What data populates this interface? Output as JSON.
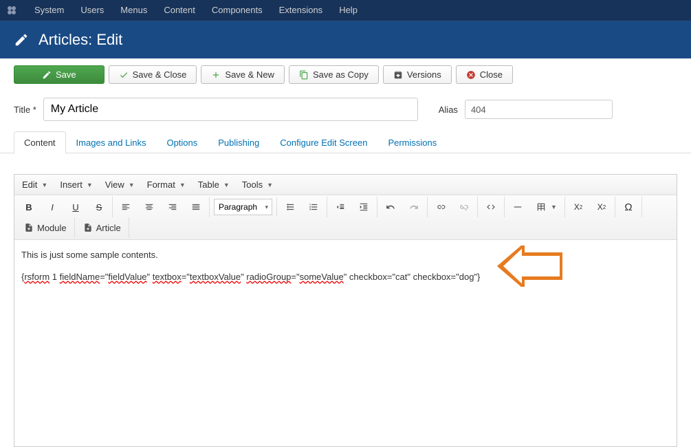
{
  "topnav": {
    "items": [
      "System",
      "Users",
      "Menus",
      "Content",
      "Components",
      "Extensions",
      "Help"
    ]
  },
  "header": {
    "title": "Articles: Edit"
  },
  "toolbar": {
    "save": "Save",
    "save_close": "Save & Close",
    "save_new": "Save & New",
    "save_copy": "Save as Copy",
    "versions": "Versions",
    "close": "Close"
  },
  "form": {
    "title_label": "Title *",
    "title_value": "My Article",
    "alias_label": "Alias",
    "alias_value": "404"
  },
  "tabs": {
    "content": "Content",
    "images": "Images and Links",
    "options": "Options",
    "publishing": "Publishing",
    "configure": "Configure Edit Screen",
    "permissions": "Permissions"
  },
  "editor_menus": {
    "edit": "Edit",
    "insert": "Insert",
    "view": "View",
    "format": "Format",
    "table": "Table",
    "tools": "Tools"
  },
  "editor_toolbar": {
    "paragraph": "Paragraph",
    "module_btn": "Module",
    "article_btn": "Article"
  },
  "content": {
    "line1": "This is just some sample contents.",
    "line2_parts": {
      "p1": "{",
      "p2": "rsform",
      "p3": " 1 ",
      "p4": "fieldName",
      "p5": "=\"",
      "p6": "fieldValue",
      "p7": "\" ",
      "p8": "textbox",
      "p9": "=\"",
      "p10": "textboxValue",
      "p11": "\" ",
      "p12": "radioGroup",
      "p13": "=\"",
      "p14": "someValue",
      "p15": "\" checkbox=\"cat\" checkbox=\"dog\"}"
    }
  },
  "colors": {
    "arrow": "#e67b1f"
  }
}
